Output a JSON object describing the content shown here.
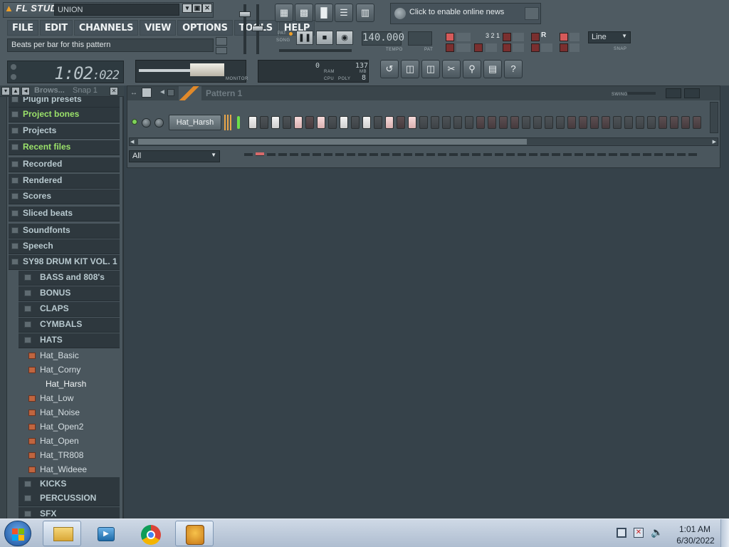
{
  "app": {
    "logo": "FL STUDIO",
    "project_name": "UNION",
    "window_buttons": [
      "▾",
      "▣",
      "✕"
    ]
  },
  "menu": {
    "items": [
      "FILE",
      "EDIT",
      "CHANNELS",
      "VIEW",
      "OPTIONS",
      "TOOLS",
      "HELP"
    ]
  },
  "hint": "Beats per bar for this pattern",
  "time": {
    "main": "1:02",
    "fraction": ":022"
  },
  "transport": {
    "pat_label": "PAT",
    "song_label": "SONG",
    "tempo": "140.000",
    "tempo_label": "TEMPO",
    "pat_box_label": "PAT",
    "monitor_label": "MONITOR"
  },
  "cpu": {
    "ram_value": "0",
    "ram_label": "RAM",
    "cpu_label": "CPU",
    "poly_label": "POLY",
    "mb_value": "137",
    "mb_label": "MB",
    "poly_value": "8"
  },
  "news": {
    "text": "Click to enable online news"
  },
  "snap": {
    "value": "Line",
    "label": "SNAP"
  },
  "browser": {
    "title": "Brows...",
    "snap": "Snap 1",
    "items": [
      {
        "label": "Plugin presets",
        "kind": "folder"
      },
      {
        "label": "Project bones",
        "kind": "folder-green"
      },
      {
        "label": "Projects",
        "kind": "folder"
      },
      {
        "label": "Recent files",
        "kind": "folder-green"
      },
      {
        "label": "Recorded",
        "kind": "folder"
      },
      {
        "label": "Rendered",
        "kind": "folder"
      },
      {
        "label": "Scores",
        "kind": "folder"
      },
      {
        "label": "Sliced beats",
        "kind": "folder"
      },
      {
        "label": "Soundfonts",
        "kind": "folder"
      },
      {
        "label": "Speech",
        "kind": "folder"
      },
      {
        "label": "SY98 DRUM KIT VOL. 1",
        "kind": "folder"
      },
      {
        "label": "BASS and 808's",
        "kind": "sub"
      },
      {
        "label": "BONUS",
        "kind": "sub"
      },
      {
        "label": "CLAPS",
        "kind": "sub"
      },
      {
        "label": "CYMBALS",
        "kind": "sub"
      },
      {
        "label": "HATS",
        "kind": "sub"
      },
      {
        "label": "Hat_Basic",
        "kind": "file"
      },
      {
        "label": "Hat_Corny",
        "kind": "file"
      },
      {
        "label": "Hat_Harsh",
        "kind": "file-selected"
      },
      {
        "label": "Hat_Low",
        "kind": "file"
      },
      {
        "label": "Hat_Noise",
        "kind": "file"
      },
      {
        "label": "Hat_Open2",
        "kind": "file"
      },
      {
        "label": "Hat_Open",
        "kind": "file"
      },
      {
        "label": "Hat_TR808",
        "kind": "file"
      },
      {
        "label": "Hat_Wideee",
        "kind": "file"
      },
      {
        "label": "KICKS",
        "kind": "sub"
      },
      {
        "label": "PERCUSSION",
        "kind": "sub"
      },
      {
        "label": "SFX",
        "kind": "sub"
      }
    ]
  },
  "sequencer": {
    "pattern": "Pattern 1",
    "swing_label": "SWING",
    "channel_name": "Hat_Harsh",
    "filter": "All",
    "steps": [
      "on",
      "off-b",
      "on",
      "off-b",
      "pink",
      "off-a",
      "pink",
      "off-b",
      "on",
      "off-b",
      "on",
      "off-b",
      "pink",
      "off-a",
      "pink",
      "off-b",
      "off-b",
      "off-b",
      "off-b",
      "off-b",
      "off-a",
      "off-a",
      "off-a",
      "off-a",
      "off-b",
      "off-b",
      "off-b",
      "off-b",
      "off-a",
      "off-a",
      "off-a",
      "off-a",
      "off-b",
      "off-b",
      "off-b",
      "off-b",
      "off-a",
      "off-a",
      "off-a",
      "off-a"
    ]
  },
  "taskbar": {
    "apps": [
      "start",
      "explorer",
      "media-player",
      "chrome",
      "fl-studio"
    ],
    "time": "1:01 AM",
    "date": "6/30/2022"
  },
  "colors": {
    "background": "#36424a",
    "panel": "#4a565d",
    "accent_green": "#9be26a",
    "step_on": "#f3f3f3",
    "step_pink": "#f6dada"
  }
}
